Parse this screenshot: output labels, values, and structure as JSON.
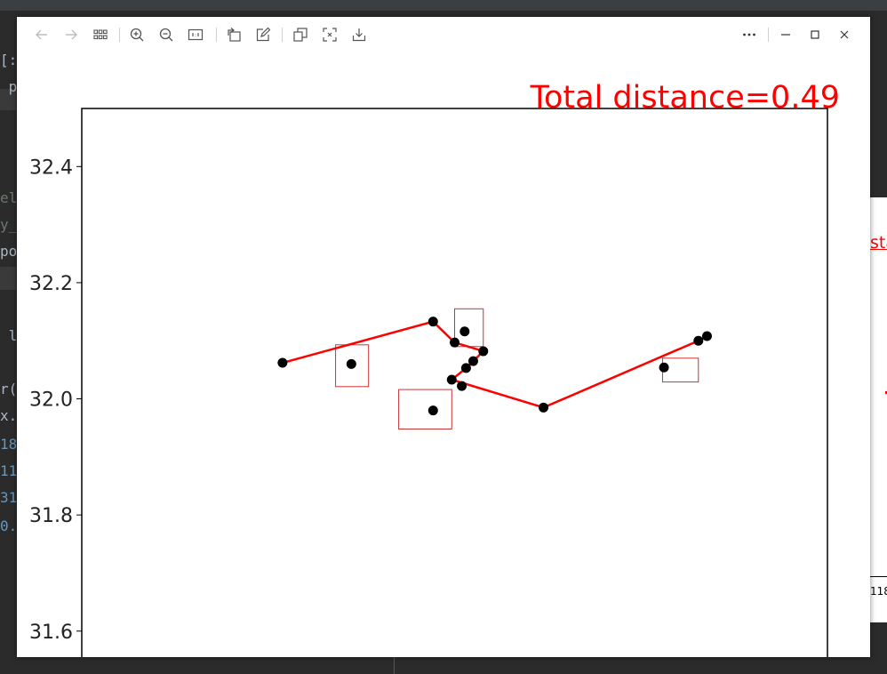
{
  "background_code": {
    "lines": [
      {
        "text": "[:",
        "style": "plain"
      },
      {
        "text": " p",
        "style": "plain"
      },
      {
        "text": "el",
        "style": "dim"
      },
      {
        "text": "y_",
        "style": "dim"
      },
      {
        "text": "po",
        "style": "plain"
      },
      {
        "text": " l",
        "style": "plain"
      },
      {
        "text": "r(",
        "style": "plain"
      },
      {
        "text": "x.",
        "style": "plain"
      },
      {
        "text": "18",
        "style": "num"
      },
      {
        "text": "11",
        "style": "num"
      },
      {
        "text": "31",
        "style": "num"
      },
      {
        "text": "0.",
        "style": "num"
      }
    ]
  },
  "peek_window": {
    "title_fragment": "sta",
    "tick_fragment": "118"
  },
  "toolbar": {
    "buttons": [
      {
        "name": "back-button",
        "icon": "arrow-left-icon",
        "enabled": false
      },
      {
        "name": "forward-button",
        "icon": "arrow-right-icon",
        "enabled": false
      },
      {
        "name": "grid-view-button",
        "icon": "grid-icon",
        "enabled": true
      },
      {
        "name": "zoom-in-button",
        "icon": "zoom-in-icon",
        "enabled": true
      },
      {
        "name": "zoom-out-button",
        "icon": "zoom-out-icon",
        "enabled": true
      },
      {
        "name": "actual-size-button",
        "icon": "actual-size-icon",
        "enabled": true
      },
      {
        "name": "rotate-button",
        "icon": "rotate-icon",
        "enabled": true
      },
      {
        "name": "edit-button",
        "icon": "edit-icon",
        "enabled": true
      },
      {
        "name": "copy-button",
        "icon": "copy-icon",
        "enabled": true
      },
      {
        "name": "fit-button",
        "icon": "fit-icon",
        "enabled": true
      },
      {
        "name": "save-button",
        "icon": "download-icon",
        "enabled": true
      },
      {
        "name": "more-button",
        "icon": "more-icon",
        "enabled": true
      },
      {
        "name": "minimize-button",
        "icon": "minimize-icon",
        "enabled": true
      },
      {
        "name": "maximize-button",
        "icon": "maximize-icon",
        "enabled": true
      },
      {
        "name": "close-button",
        "icon": "close-icon",
        "enabled": true
      }
    ]
  },
  "chart_data": {
    "type": "line",
    "title": "Total distance=0.49",
    "title_color": "#ff0000",
    "ylim": [
      31.52,
      32.5
    ],
    "xlim": [
      117.9,
      118.42
    ],
    "y_ticks": [
      "32.4",
      "32.2",
      "32.0",
      "31.8",
      "31.6"
    ],
    "y_tick_values": [
      32.4,
      32.2,
      32.0,
      31.8,
      31.6
    ],
    "route_color": "#ff0000",
    "point_color": "#000000",
    "route": [
      {
        "x": 118.04,
        "y": 32.062
      },
      {
        "x": 118.145,
        "y": 32.133
      },
      {
        "x": 118.16,
        "y": 32.097
      },
      {
        "x": 118.18,
        "y": 32.082
      },
      {
        "x": 118.173,
        "y": 32.065
      },
      {
        "x": 118.168,
        "y": 32.053
      },
      {
        "x": 118.158,
        "y": 32.033
      },
      {
        "x": 118.222,
        "y": 31.985
      },
      {
        "x": 118.33,
        "y": 32.1
      },
      {
        "x": 118.336,
        "y": 32.108
      }
    ],
    "unvisited_points": [
      {
        "x": 118.088,
        "y": 32.06
      },
      {
        "x": 118.167,
        "y": 32.116
      },
      {
        "x": 118.145,
        "y": 31.98
      },
      {
        "x": 118.165,
        "y": 32.022
      },
      {
        "x": 118.306,
        "y": 32.054
      }
    ],
    "highlight_boxes": [
      {
        "x0": 118.077,
        "x1": 118.1,
        "y0": 32.021,
        "y1": 32.093
      },
      {
        "x0": 118.16,
        "x1": 118.18,
        "y0": 32.09,
        "y1": 32.155
      },
      {
        "x0": 118.121,
        "x1": 118.158,
        "y0": 31.948,
        "y1": 32.016
      },
      {
        "x0": 118.305,
        "x1": 118.33,
        "y0": 32.029,
        "y1": 32.07
      }
    ],
    "box_color": "#cc3333",
    "grid": false
  }
}
